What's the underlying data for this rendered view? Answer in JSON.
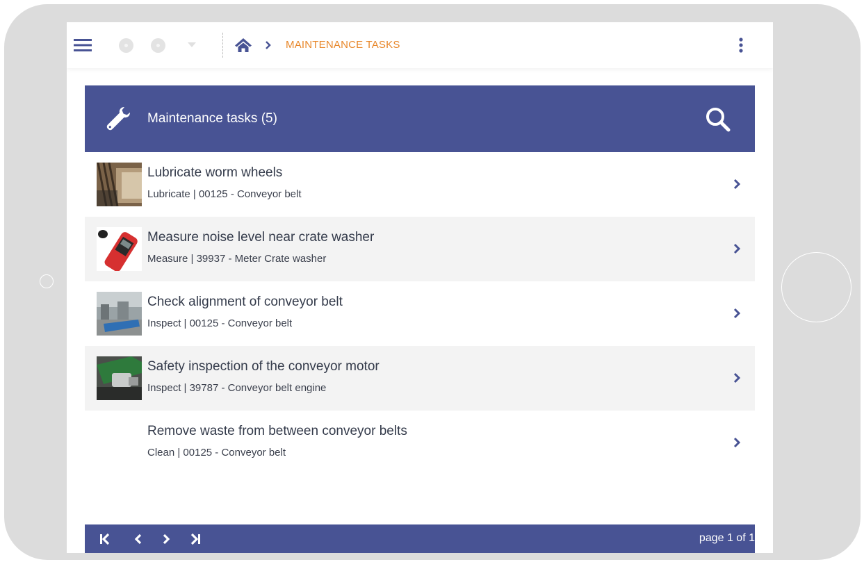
{
  "topbar": {
    "breadcrumb_current": "MAINTENANCE TASKS",
    "accent_color": "#e8872a"
  },
  "panel": {
    "title": "Maintenance tasks (5)",
    "header_color": "#485394"
  },
  "tasks": [
    {
      "title": "Lubricate worm wheels",
      "subtitle": "Lubricate | 00125 - Conveyor belt",
      "thumbnail": "worm-gear-photo"
    },
    {
      "title": "Measure noise level near crate washer",
      "subtitle": "Measure | 39937 - Meter Crate washer",
      "thumbnail": "sound-meter-photo"
    },
    {
      "title": "Check alignment of conveyor belt",
      "subtitle": "Inspect | 00125 - Conveyor belt",
      "thumbnail": "factory-hall-photo"
    },
    {
      "title": "Safety inspection of the conveyor motor",
      "subtitle": "Inspect | 39787 - Conveyor belt engine",
      "thumbnail": "conveyor-motor-photo"
    },
    {
      "title": "Remove waste from between conveyor belts",
      "subtitle": "Clean | 00125 - Conveyor belt",
      "thumbnail": ""
    }
  ],
  "pager": {
    "text": "page 1 of 1"
  }
}
